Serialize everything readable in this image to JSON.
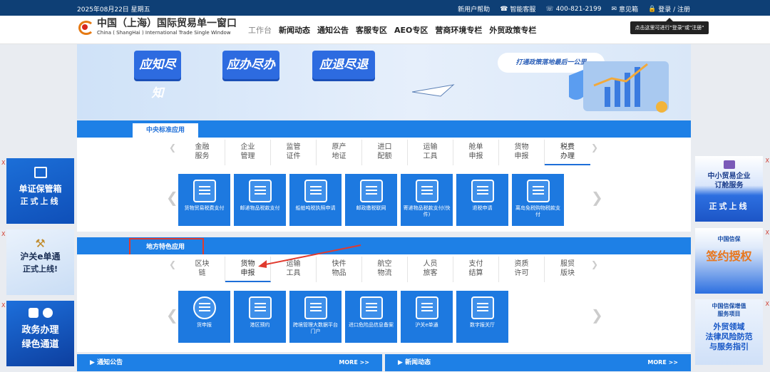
{
  "topbar": {
    "date": "2025年08月22日 星期五",
    "links": [
      "新用户帮助",
      "智能客服",
      "400-821-2199",
      "意见箱",
      "登录 / 注册"
    ]
  },
  "logo": {
    "title": "中国（上海）国际贸易单一窗口",
    "subtitle": "China ( ShangHai ) International Trade Single Window"
  },
  "nav": [
    "工作台",
    "新闻动态",
    "通知公告",
    "客服专区",
    "AEO专区",
    "营商环境专栏",
    "外贸政策专栏"
  ],
  "tooltip": "点击这里可进行\"登录\"或\"注册\"",
  "banner": {
    "pill1": "应知尽知",
    "pill2": "应办尽办",
    "pill3": "应退尽退",
    "slogan": "打通政策落地最后一公里"
  },
  "central": {
    "title": "中央标准应用",
    "tabs": [
      {
        "l1": "金融",
        "l2": "服务"
      },
      {
        "l1": "企业",
        "l2": "管理"
      },
      {
        "l1": "监管",
        "l2": "证件"
      },
      {
        "l1": "原产",
        "l2": "地证"
      },
      {
        "l1": "进口",
        "l2": "配额"
      },
      {
        "l1": "运输",
        "l2": "工具"
      },
      {
        "l1": "舱单",
        "l2": "申报"
      },
      {
        "l1": "货物",
        "l2": "申报"
      },
      {
        "l1": "税费",
        "l2": "办理"
      }
    ],
    "tiles": [
      "货物贸易税费支付",
      "邮递物品税款支付",
      "船舶吨税执照申请",
      "邮政缴税联网",
      "寄递物品税款支付(快件)",
      "退税申请",
      "离岛免税购物税款支付"
    ]
  },
  "local": {
    "title": "地方特色应用",
    "tabs": [
      {
        "l1": "区块",
        "l2": "链"
      },
      {
        "l1": "货物",
        "l2": "申报"
      },
      {
        "l1": "运输",
        "l2": "工具"
      },
      {
        "l1": "快件",
        "l2": "物品"
      },
      {
        "l1": "航空",
        "l2": "物流"
      },
      {
        "l1": "人员",
        "l2": "旅客"
      },
      {
        "l1": "支付",
        "l2": "结算"
      },
      {
        "l1": "资质",
        "l2": "许可"
      },
      {
        "l1": "服贸",
        "l2": "版块"
      }
    ],
    "tiles": [
      "货申报",
      "港区预约",
      "跨境管理大数据平台门户",
      "进口危险品信息备案",
      "沪关e单通",
      "数字报关厅"
    ]
  },
  "left_ads": [
    {
      "l1": "单证保管箱",
      "l2": "正式上线"
    },
    {
      "l1": "沪关e单通",
      "l2": "正式上线!"
    },
    {
      "l1": "政务办理",
      "l2": "绿色通道"
    }
  ],
  "right_ads": [
    {
      "l1": "中小贸易企业",
      "l2": "订舱服务",
      "l3": "正式上线"
    },
    {
      "l1": "中国信保",
      "l2": "签约授权"
    },
    {
      "l1": "中国信保增值",
      "l2": "服务项目",
      "l3": "外贸领域",
      "l4": "法律风险防范",
      "l5": "与服务指引"
    }
  ],
  "bottom": {
    "notice": "通知公告",
    "news": "新闻动态",
    "more": "MORE >>"
  },
  "close": "X"
}
